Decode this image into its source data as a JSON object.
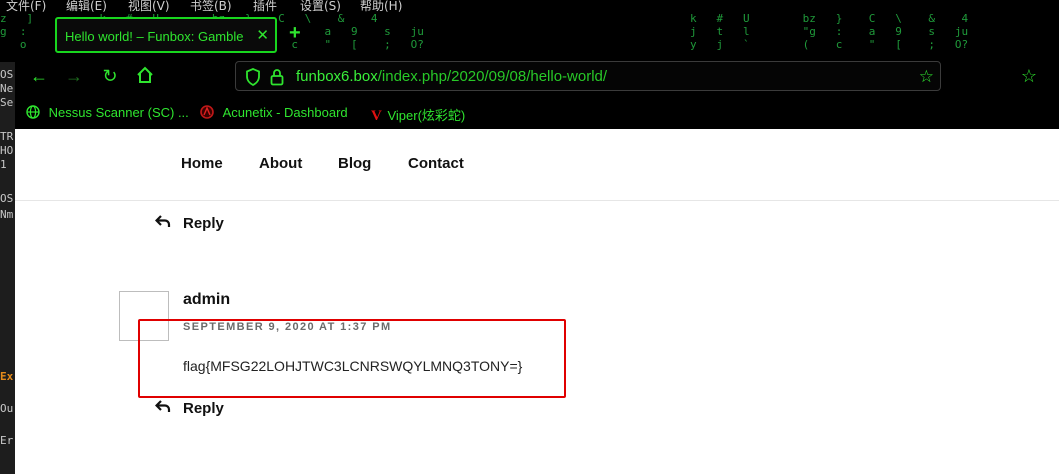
{
  "menubar": {
    "items": [
      "文件(F)",
      "编辑(E)",
      "视图(V)",
      "书签(B)",
      "插件",
      "设置(S)",
      "帮助(H)"
    ]
  },
  "tab": {
    "title": "Hello world! – Funbox: Gamble",
    "close_glyph": "✕",
    "new_tab_glyph": "+"
  },
  "terminal": {
    "lines": [
      "OS",
      "Ne",
      "Se",
      "TR",
      "HO",
      "1",
      "OS",
      "Nm",
      "Ex",
      "Ou",
      "Er"
    ]
  },
  "nav": {
    "url_host": "funbox6.box",
    "url_path": "/index.php/2020/09/08/hello-world/"
  },
  "bookmarks": [
    {
      "label": "Nessus Scanner (SC) ...",
      "icon": "globe-icon"
    },
    {
      "label": "Acunetix - Dashboard",
      "icon": "acunetix-icon"
    },
    {
      "label": "Viper(炫彩蛇)",
      "icon": "viper-icon"
    }
  ],
  "site_menu": [
    "Home",
    "About",
    "Blog",
    "Contact"
  ],
  "comment": {
    "reply_label": "Reply",
    "author": "admin",
    "date": "SEPTEMBER 9, 2020 AT 1:37 PM",
    "text": "flag{MFSG22LOHJTWC3LCNRSWQYLMNQ3TONY=}",
    "reply_label_2": "Reply"
  },
  "colors": {
    "accent": "#2fe52f",
    "highlight": "#e00000"
  }
}
